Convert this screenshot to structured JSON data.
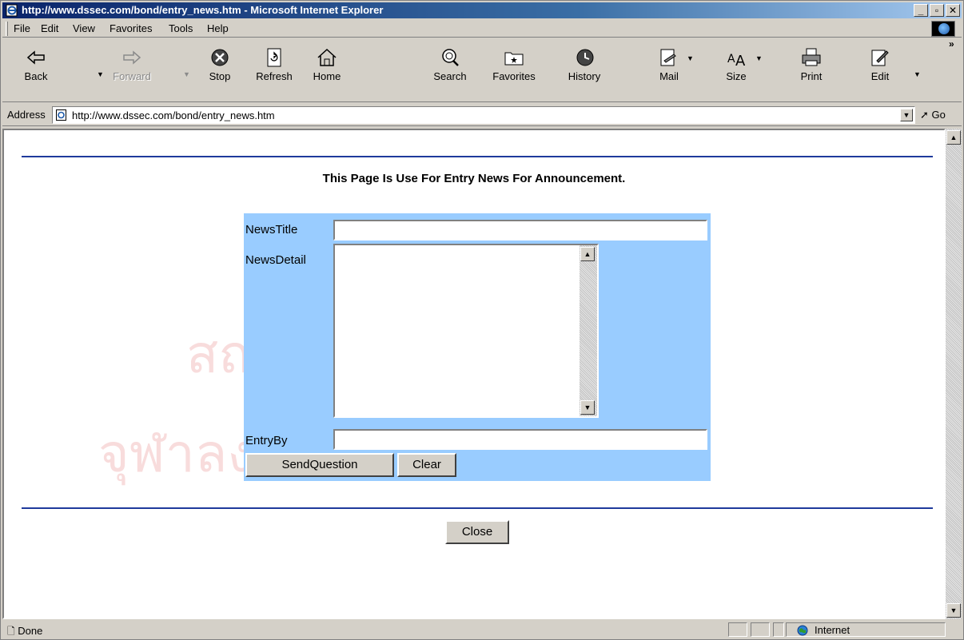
{
  "window": {
    "title": "http://www.dssec.com/bond/entry_news.htm - Microsoft Internet Explorer"
  },
  "menu": [
    "File",
    "Edit",
    "View",
    "Favorites",
    "Tools",
    "Help"
  ],
  "toolbar": {
    "back": "Back",
    "forward": "Forward",
    "stop": "Stop",
    "refresh": "Refresh",
    "home": "Home",
    "search": "Search",
    "favorites": "Favorites",
    "history": "History",
    "mail": "Mail",
    "size": "Size",
    "print": "Print",
    "edit": "Edit"
  },
  "address": {
    "label": "Address",
    "url": "http://www.dssec.com/bond/entry_news.htm",
    "go": "Go"
  },
  "page": {
    "heading": "This Page Is Use For Entry News For Announcement.",
    "form": {
      "title_label": "NewsTitle",
      "title_value": "",
      "detail_label": "NewsDetail",
      "detail_value": "",
      "entry_label": "EntryBy",
      "entry_value": "",
      "send_label": "SendQuestion",
      "clear_label": "Clear"
    },
    "close_label": "Close",
    "watermark_line1": "สถาบันวิทยบริการ",
    "watermark_line2": "จุฬาลงกรณ์มหาวิทยาลัย"
  },
  "status": {
    "text": "Done",
    "zone": "Internet"
  }
}
